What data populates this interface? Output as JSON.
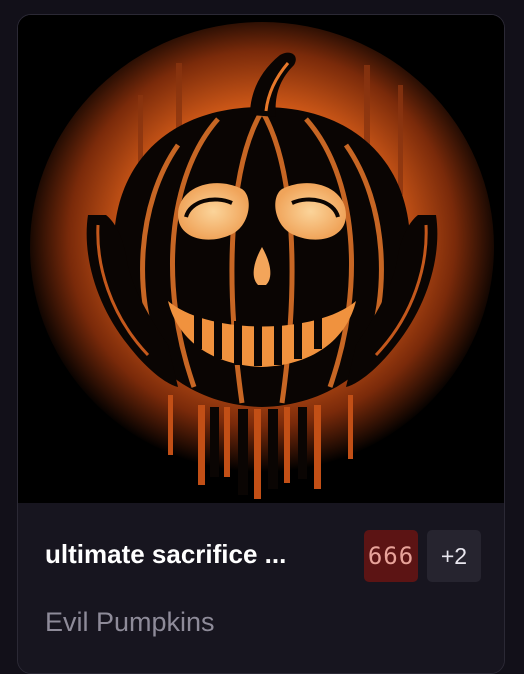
{
  "card": {
    "image": {
      "name": "evil-pumpkin-skull-artwork"
    },
    "title": "ultimate sacrifice ...",
    "badges": [
      {
        "label": "666",
        "background": "#5c1414",
        "color": "#e8a39a"
      },
      {
        "label": "+2",
        "background": "#26242f",
        "color": "#e9e7ef"
      }
    ],
    "collection": "Evil Pumpkins"
  },
  "colors": {
    "page_background": "#121019",
    "card_background": "#17151f",
    "card_border": "#2b2935",
    "art_glow": "#e36a1c",
    "art_highlight": "#f6b56e",
    "art_dark": "#000000"
  }
}
